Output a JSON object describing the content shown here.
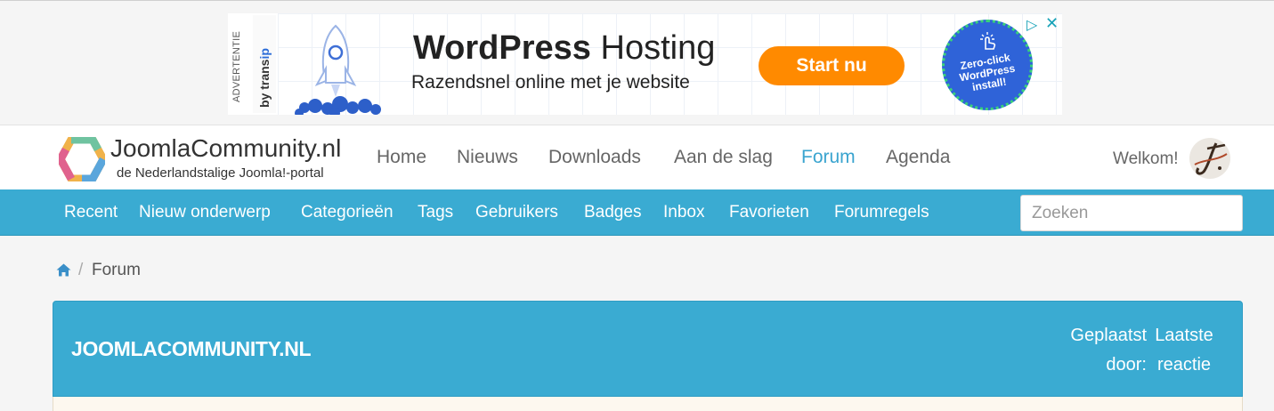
{
  "ad": {
    "label": "ADVERTENTIE",
    "sponsor_prefix": "by trans",
    "sponsor_suffix": "ip",
    "headline_strong": "WordPress",
    "headline_rest": " Hosting",
    "subline": "Razendsnel online met je website",
    "cta": "Start nu",
    "badge_lines": [
      "Zero-click",
      "WordPress",
      "install!"
    ],
    "choices_icon": "ad-choices-icon",
    "close_icon": "close-icon",
    "colors": {
      "cta": "#ff8a00",
      "badge": "#2f63d8",
      "badge_ring": "#3ad27a"
    }
  },
  "header": {
    "site_name": "JoomlaCommunity.nl",
    "tagline": "de Nederlandstalige Joomla!-portal",
    "nav": [
      {
        "label": "Home",
        "active": false
      },
      {
        "label": "Nieuws",
        "active": false
      },
      {
        "label": "Downloads",
        "active": false
      },
      {
        "label": "Aan de slag",
        "active": false
      },
      {
        "label": "Forum",
        "active": true
      },
      {
        "label": "Agenda",
        "active": false
      }
    ],
    "welcome": "Welkom!",
    "accent_color": "#3aa4cf"
  },
  "forum_menu": {
    "items": [
      "Recent",
      "Nieuw onderwerp",
      "Categorieën",
      "Tags",
      "Gebruikers",
      "Badges",
      "Inbox",
      "Favorieten",
      "Forumregels"
    ],
    "search_placeholder": "Zoeken",
    "bar_color": "#3aabd2"
  },
  "breadcrumb": {
    "home_icon": "home-icon",
    "separator": "/",
    "current": "Forum"
  },
  "category": {
    "title": "JOOMLACOMMUNITY.NL",
    "col_posted": [
      "Geplaatst",
      "door:"
    ],
    "col_last": [
      "Laatste",
      "reactie"
    ]
  }
}
